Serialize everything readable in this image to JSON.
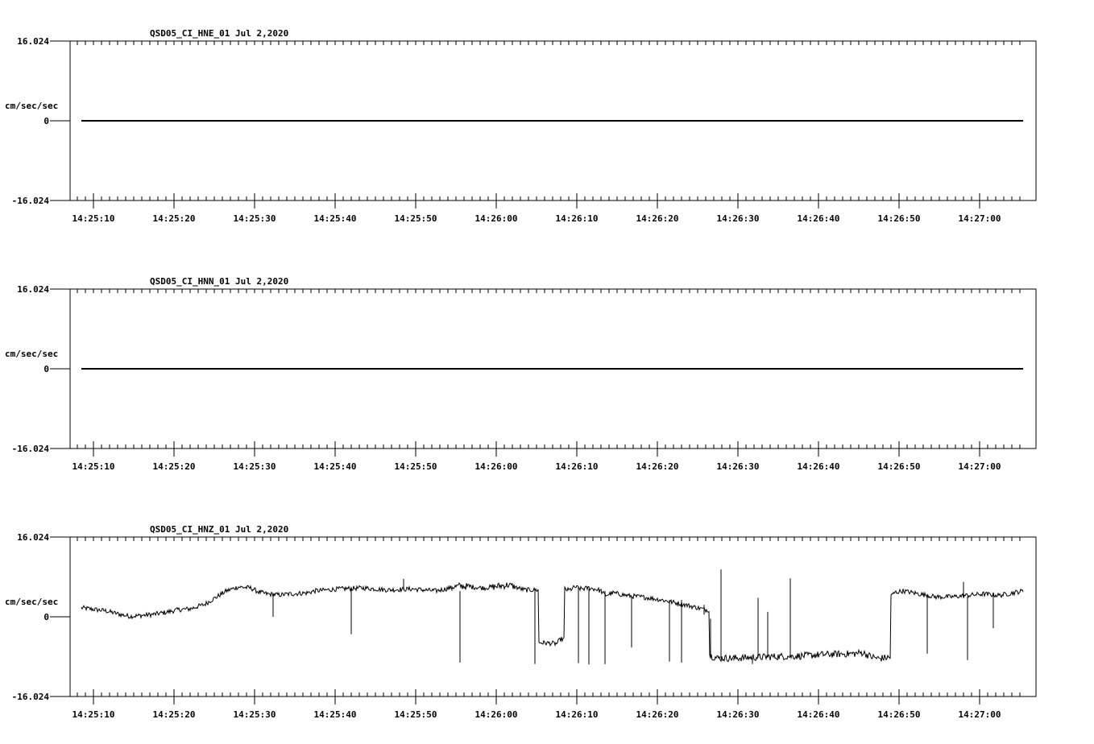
{
  "chart_data": [
    {
      "type": "line",
      "title": "QSD05_CI_HNE_01  Jul 2,2020",
      "ylabel": "cm/sec/sec",
      "ylim": [
        -16.024,
        16.024
      ],
      "y_tick_labels": [
        "16.024",
        "0",
        "-16.024"
      ],
      "x_tick_labels": [
        "14:25:10",
        "14:25:20",
        "14:25:30",
        "14:25:40",
        "14:25:50",
        "14:26:00",
        "14:26:10",
        "14:26:20",
        "14:26:30",
        "14:26:40",
        "14:26:50",
        "14:27:00"
      ],
      "xlim_seconds": [
        -1.2,
        116.9
      ],
      "series": [
        {
          "x": [
            0,
            116.9
          ],
          "y": [
            0,
            0
          ]
        }
      ]
    },
    {
      "type": "line",
      "title": "QSD05_CI_HNN_01  Jul 2,2020",
      "ylabel": "cm/sec/sec",
      "ylim": [
        -16.024,
        16.024
      ],
      "y_tick_labels": [
        "16.024",
        "0",
        "-16.024"
      ],
      "x_tick_labels": [
        "14:25:10",
        "14:25:20",
        "14:25:30",
        "14:25:40",
        "14:25:50",
        "14:26:00",
        "14:26:10",
        "14:26:20",
        "14:26:30",
        "14:26:40",
        "14:26:50",
        "14:27:00"
      ],
      "xlim_seconds": [
        -1.2,
        116.9
      ],
      "series": [
        {
          "x": [
            0,
            116.9
          ],
          "y": [
            0,
            0
          ]
        }
      ]
    },
    {
      "type": "line",
      "title": "QSD05_CI_HNZ_01  Jul 2,2020",
      "ylabel": "cm/sec/sec",
      "ylim": [
        -16.024,
        16.024
      ],
      "y_tick_labels": [
        "16.024",
        "0",
        "-16.024"
      ],
      "x_tick_labels": [
        "14:25:10",
        "14:25:20",
        "14:25:30",
        "14:25:40",
        "14:25:50",
        "14:26:00",
        "14:26:10",
        "14:26:20",
        "14:26:30",
        "14:26:40",
        "14:26:50",
        "14:27:00"
      ],
      "xlim_seconds": [
        -1.2,
        116.9
      ],
      "series": [
        {
          "x": [
            0,
            1.5,
            3,
            4,
            5,
            6,
            7,
            9,
            10.5,
            12,
            13.5,
            15.3,
            18,
            19.5,
            21,
            22,
            23,
            24.5,
            26,
            27,
            28,
            29,
            32,
            35,
            38,
            41,
            44,
            47,
            50,
            53,
            55,
            57,
            59,
            59.5,
            60,
            60.5,
            61.3,
            62,
            63,
            64,
            64.5,
            65,
            66,
            68,
            70,
            72,
            75,
            77.5,
            78,
            79,
            81,
            83,
            86,
            89,
            92,
            94,
            96,
            97,
            98,
            99,
            100,
            100.5,
            101,
            102,
            104,
            106,
            108,
            110,
            112,
            114,
            116.9
          ],
          "y": [
            1.8,
            1.5,
            1.2,
            0.8,
            0.4,
            0.1,
            0.2,
            0.5,
            0.9,
            1.4,
            1.6,
            2.5,
            5.2,
            6,
            5.8,
            5,
            4.6,
            4.4,
            4.6,
            4.7,
            4.8,
            5.2,
            5.6,
            5.8,
            5.4,
            5.6,
            5.2,
            6.2,
            5.8,
            6.4,
            5.4,
            -5.2,
            -5.4,
            -4.5,
            5.6,
            5.3,
            6.0,
            5.6,
            5.8,
            5.5,
            5.2,
            4.3,
            4.8,
            4.2,
            3.9,
            3.4,
            2.4,
            1.4,
            -7.8,
            -8.3,
            -8.3,
            -8.2,
            -8.0,
            -7.9,
            -7.6,
            -7.5,
            -7.4,
            -7.2,
            -8.0,
            -8.4,
            -8.2,
            4.2,
            4.9,
            5.2,
            4.6,
            4.0,
            4.0,
            4.3,
            4.6,
            4.3,
            5.2
          ]
        },
        {
          "x": [
            23.8,
            33.5,
            40,
            46,
            47,
            56.3,
            61.7,
            63,
            65,
            68.3,
            73,
            74.5,
            77.3,
            78.1,
            79.4,
            81,
            83.3,
            84,
            85.2,
            88,
            105,
            109.5,
            110,
            113.2
          ],
          "y": [
            0,
            -3.5,
            7.6,
            6.2,
            -9.2,
            -9.5,
            -9.3,
            -9.6,
            -9.5,
            -6.2,
            -9.0,
            -9.2,
            0.4,
            -0.4,
            9.5,
            -8.8,
            -9.5,
            3.8,
            1.0,
            7.7,
            -7.4,
            7.0,
            -8.7,
            -2.3
          ]
        }
      ]
    }
  ]
}
